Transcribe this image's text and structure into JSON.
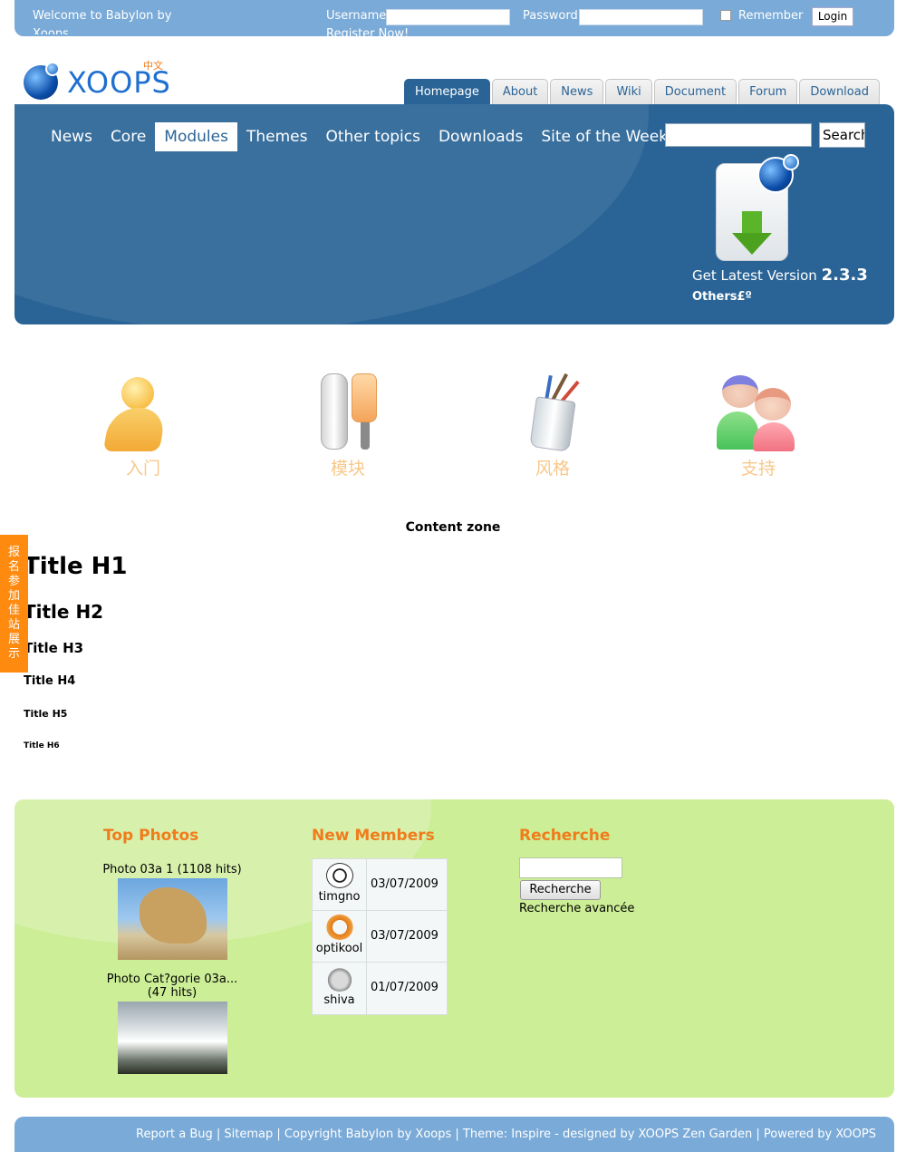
{
  "topbar": {
    "welcome": "Welcome to Babylon by Xoops",
    "username_label": "Username",
    "password_label": "Password",
    "register": "Register Now!",
    "remember": "Remember",
    "login_button": "Login"
  },
  "logo": {
    "word": "XOOPS",
    "lang": "中文"
  },
  "tabs": [
    "Homepage",
    "About",
    "News",
    "Wiki",
    "Document",
    "Forum",
    "Download"
  ],
  "nav": {
    "items": [
      "News",
      "Core",
      "Modules",
      "Themes",
      "Other topics",
      "Downloads",
      "Site of the Week"
    ],
    "search_button": "Search"
  },
  "download": {
    "text": "Get Latest Version",
    "version": "2.3.3",
    "others": "Others£º"
  },
  "features": [
    "入门",
    "模块",
    "风格",
    "支持"
  ],
  "content": {
    "zone": "Content zone",
    "h1": "Title H1",
    "h2": "Title H2",
    "h3": "Title H3",
    "h4": "Title H4",
    "h5": "Title H5",
    "h6": "Title H6"
  },
  "sidetab": [
    "报",
    "名",
    "参",
    "加",
    "佳",
    "站",
    "展",
    "示"
  ],
  "blocks": {
    "top_photos": {
      "title": "Top Photos",
      "photos": [
        {
          "caption": "Photo 03a 1 (1108 hits)"
        },
        {
          "caption": "Photo Cat?gorie 03a...",
          "hits": "(47 hits)"
        }
      ]
    },
    "new_members": {
      "title": "New Members",
      "members": [
        {
          "name": "timgno",
          "date": "03/07/2009"
        },
        {
          "name": "optikool",
          "date": "03/07/2009"
        },
        {
          "name": "shiva",
          "date": "01/07/2009"
        }
      ]
    },
    "recherche": {
      "title": "Recherche",
      "button": "Recherche",
      "advanced": "Recherche avancée"
    }
  },
  "footer": {
    "text": "Report a Bug | Sitemap | Copyright Babylon by Xoops | Theme: Inspire - designed by XOOPS Zen Garden | Powered by XOOPS"
  }
}
